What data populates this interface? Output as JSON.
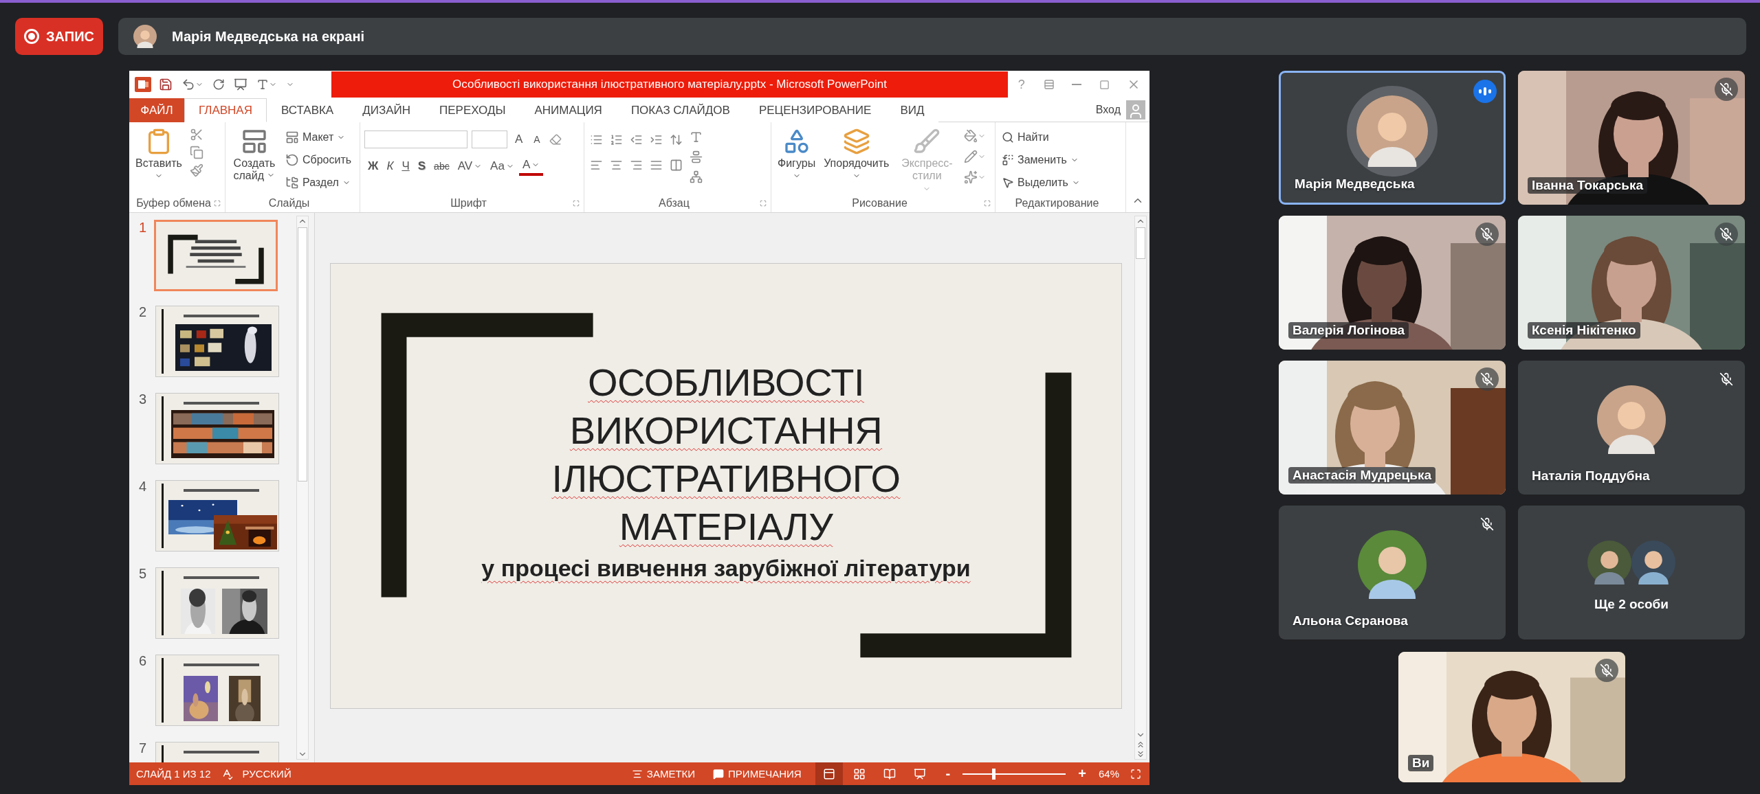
{
  "recording": {
    "label": "ЗАПИС"
  },
  "presenter_bar": {
    "text": "Марія Медведська на екрані"
  },
  "powerpoint": {
    "title": "Особливості використання ілюстративного матеріалу.pptx - Microsoft PowerPoint",
    "help": "?",
    "tabs": [
      {
        "label": "ФАЙЛ",
        "kind": "file",
        "selected": false
      },
      {
        "label": "ГЛАВНАЯ",
        "kind": "tab",
        "selected": true
      },
      {
        "label": "ВСТАВКА",
        "kind": "tab",
        "selected": false
      },
      {
        "label": "ДИЗАЙН",
        "kind": "tab",
        "selected": false
      },
      {
        "label": "ПЕРЕХОДЫ",
        "kind": "tab",
        "selected": false
      },
      {
        "label": "АНИМАЦИЯ",
        "kind": "tab",
        "selected": false
      },
      {
        "label": "ПОКАЗ СЛАЙДОВ",
        "kind": "tab",
        "selected": false
      },
      {
        "label": "РЕЦЕНЗИРОВАНИЕ",
        "kind": "tab",
        "selected": false
      },
      {
        "label": "ВИД",
        "kind": "tab",
        "selected": false
      }
    ],
    "sign_in": "Вход",
    "ribbon": [
      {
        "kind": "clipboard",
        "label": "Буфер обмена",
        "launcher": true,
        "buttons": [
          {
            "label": "Вставить"
          }
        ]
      },
      {
        "kind": "slides",
        "label": "Слайды",
        "launcher": false,
        "buttons": [
          {
            "label": "Создать слайд",
            "kind": "large"
          },
          {
            "label": "Макет",
            "kind": "small"
          },
          {
            "label": "Сбросить",
            "kind": "small"
          },
          {
            "label": "Раздел",
            "kind": "small"
          }
        ]
      },
      {
        "kind": "font",
        "label": "Шрифт",
        "launcher": true,
        "buttons": [
          {
            "label": "A",
            "kind": "grow"
          },
          {
            "label": "A",
            "kind": "shrink"
          },
          {
            "label": "Ж",
            "kind": "bold"
          },
          {
            "label": "К",
            "kind": "italic"
          },
          {
            "label": "Ч",
            "kind": "underline"
          },
          {
            "label": "S",
            "kind": "shadow"
          },
          {
            "label": "abc",
            "kind": "strike"
          },
          {
            "label": "AV",
            "kind": "spacing"
          },
          {
            "label": "Aa",
            "kind": "case"
          },
          {
            "label": "A",
            "kind": "color"
          }
        ]
      },
      {
        "kind": "paragraph",
        "label": "Абзац",
        "launcher": true
      },
      {
        "kind": "drawing",
        "label": "Рисование",
        "launcher": true,
        "buttons": [
          {
            "label": "Фигуры",
            "disabled": false
          },
          {
            "label": "Упорядочить",
            "disabled": false
          },
          {
            "label": "Экспресс-стили",
            "disabled": true
          }
        ]
      },
      {
        "kind": "editing",
        "label": "Редактирование",
        "launcher": false,
        "buttons": [
          {
            "label": "Найти"
          },
          {
            "label": "Заменить"
          },
          {
            "label": "Выделить"
          }
        ]
      }
    ],
    "thumbnails": [
      {
        "number": "1",
        "selected": true
      },
      {
        "number": "2",
        "selected": false
      },
      {
        "number": "3",
        "selected": false
      },
      {
        "number": "4",
        "selected": false
      },
      {
        "number": "5",
        "selected": false
      },
      {
        "number": "6",
        "selected": false
      },
      {
        "number": "7",
        "selected": false
      }
    ],
    "slide": {
      "title_lines": [
        "ОСОБЛИВОСТІ",
        "ВИКОРИСТАННЯ",
        "ІЛЮСТРАТИВНОГО",
        "МАТЕРІАЛУ"
      ],
      "subtitle": "у процесі вивчення зарубіжної літератури"
    },
    "status_bar": {
      "slide_info": "СЛАЙД 1 ИЗ 12",
      "language": "РУССКИЙ",
      "notes": "ЗАМЕТКИ",
      "comments": "ПРИМЕЧАНИЯ",
      "views": [
        {
          "selected": true
        },
        {
          "selected": false
        },
        {
          "selected": false
        },
        {
          "selected": false
        }
      ],
      "zoom": {
        "minus": "-",
        "plus": "+",
        "level": 0.3,
        "reading": "64%"
      }
    }
  },
  "participants": [
    {
      "name": "Марія Медведська",
      "kind": "avatar",
      "muted": false,
      "speaking": true
    },
    {
      "name": "Іванна Токарська",
      "kind": "video",
      "muted": true,
      "speaking": false
    },
    {
      "name": "Валерія Логінова",
      "kind": "video",
      "muted": true,
      "speaking": false
    },
    {
      "name": "Ксенія Нікітенко",
      "kind": "video",
      "muted": true,
      "speaking": false
    },
    {
      "name": "Анастасія Мудрецька",
      "kind": "video",
      "muted": true,
      "speaking": false
    },
    {
      "name": "Наталія Поддубна",
      "kind": "avatar",
      "muted": true,
      "speaking": false
    },
    {
      "name": "Альона Сєранова",
      "kind": "avatar",
      "muted": true,
      "speaking": false
    },
    {
      "name": "Ще 2 особи",
      "kind": "more",
      "muted": false,
      "speaking": false
    }
  ],
  "self_tile": {
    "name": "Ви",
    "kind": "video",
    "muted": true
  }
}
